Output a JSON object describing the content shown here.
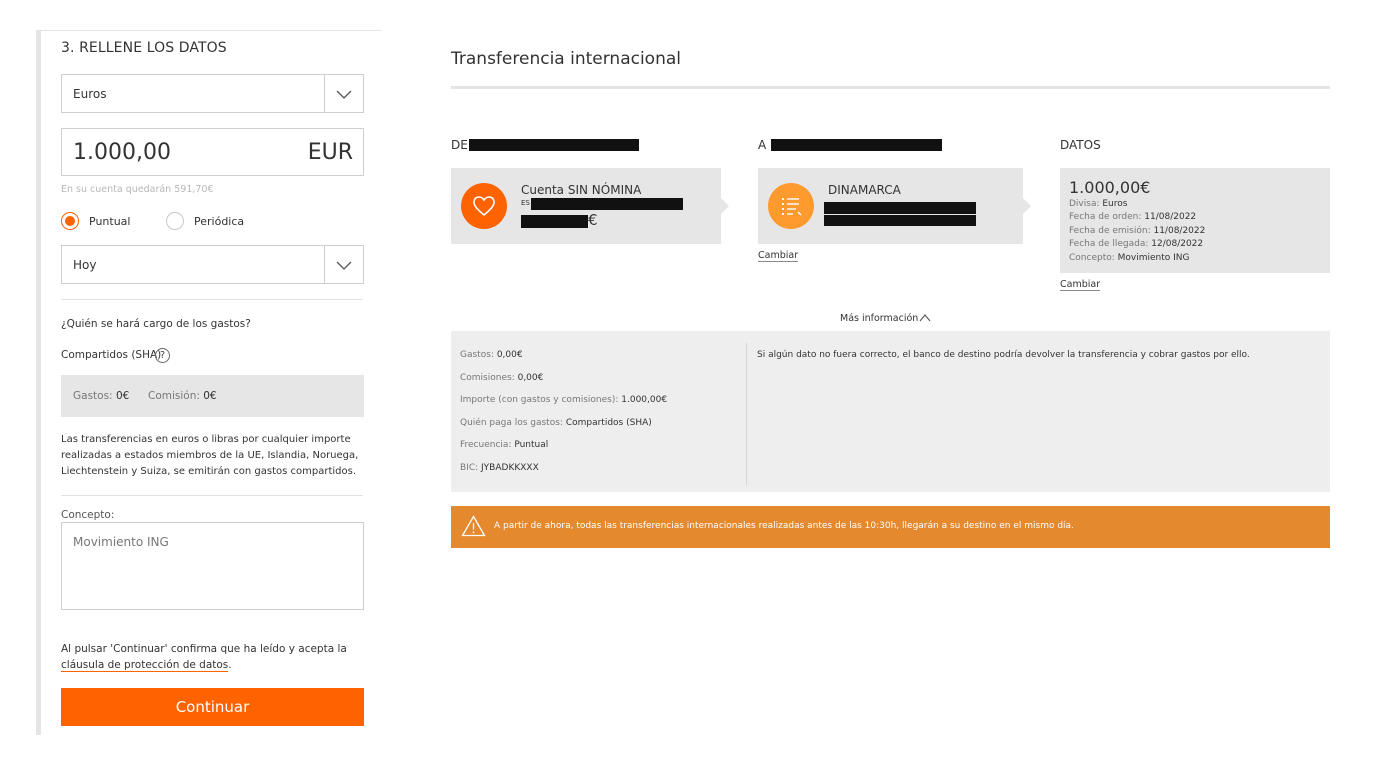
{
  "form": {
    "step_title": "3. RELLENE LOS DATOS",
    "currency_select": "Euros",
    "amount": "1.000,00",
    "amount_currency": "EUR",
    "balance_note": "En su cuenta quedarán 591,70€",
    "frequency_options": [
      "Puntual",
      "Periódica"
    ],
    "frequency_selected": "Puntual",
    "date_select": "Hoy",
    "fees_question": "¿Quién se hará cargo de los gastos?",
    "fees_option": "Compartidos (SHA)",
    "help_glyph": "?",
    "fees_label": "Gastos:",
    "fees_value": "0€",
    "commission_label": "Comisión:",
    "commission_value": "0€",
    "info_text": "Las transferencias en euros o libras por cualquier importe realizadas a estados miembros de la UE, Islandia, Noruega, Liechtenstein y Suiza, se emitirán con gastos compartidos.",
    "concept_label": "Concepto:",
    "concept_value": "Movimiento ING",
    "consent_prefix": "Al pulsar 'Continuar' confirma que ha leído y acepta la ",
    "consent_link": "cláusula de protección de datos",
    "consent_suffix": ".",
    "continue_button": "Continuar"
  },
  "summary": {
    "title": "Transferencia internacional",
    "from_label": "DE",
    "to_label": "A",
    "datos_label": "DATOS",
    "from_account_name": "Cuenta SIN NÓMINA",
    "from_account_prefix": "ES",
    "from_balance_suffix": "€",
    "to_country": "DINAMARCA",
    "change_link": "Cambiar",
    "datos": {
      "amount": "1.000,00€",
      "lines": [
        {
          "label": "Divisa:",
          "value": "Euros"
        },
        {
          "label": "Fecha de orden:",
          "value": "11/08/2022"
        },
        {
          "label": "Fecha de emisión:",
          "value": "11/08/2022"
        },
        {
          "label": "Fecha de llegada:",
          "value": "12/08/2022"
        },
        {
          "label": "Concepto:",
          "value": "Movimiento ING"
        }
      ]
    },
    "more_info": "Más información",
    "details": [
      {
        "label": "Gastos:",
        "value": "0,00€"
      },
      {
        "label": "Comisiones:",
        "value": "0,00€"
      },
      {
        "label": "Importe (con gastos y comisiones):",
        "value": "1.000,00€"
      },
      {
        "label": "Quién paga los gastos:",
        "value": "Compartidos (SHA)"
      },
      {
        "label": "Frecuencia:",
        "value": "Puntual"
      },
      {
        "label": "BIC:",
        "value": "JYBADKKXXX"
      }
    ],
    "details_note": "Si algún dato no fuera correcto, el banco de destino podría devolver la transferencia y cobrar gastos por ello.",
    "banner": "A partir de ahora, todas las transferencias internacionales realizadas antes de las 10:30h, llegarán a su destino en el mismo día."
  },
  "colors": {
    "accent": "#ff6200",
    "accent_light": "#ff9a2e",
    "banner": "#e5892f",
    "panel_gray": "#e6e6e6"
  },
  "icons": [
    "chevron-down-icon",
    "help-icon",
    "heart-icon",
    "list-icon",
    "chevron-up-icon",
    "warning-icon"
  ]
}
